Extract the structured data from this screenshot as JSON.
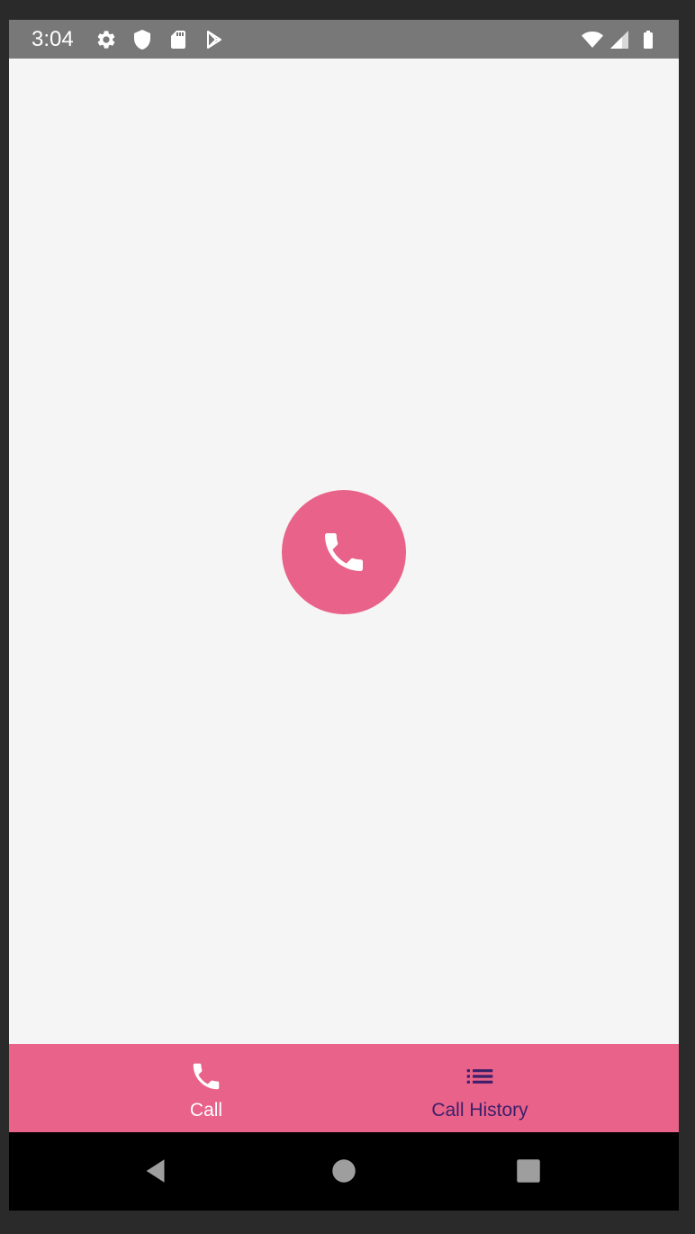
{
  "status_bar": {
    "time": "3:04",
    "left_icons": [
      "settings-icon",
      "shield-icon",
      "sd-card-icon",
      "play-store-icon"
    ],
    "right_icons": [
      "wifi-icon",
      "signal-icon",
      "battery-icon"
    ],
    "background_color": "#787878"
  },
  "main": {
    "call_button": {
      "icon": "phone-icon",
      "color": "#e9628a"
    }
  },
  "bottom_nav": {
    "background_color": "#e9628a",
    "items": [
      {
        "label": "Call",
        "icon": "phone-icon",
        "active": true
      },
      {
        "label": "Call History",
        "icon": "list-icon",
        "active": false
      }
    ]
  },
  "system_nav": {
    "buttons": [
      "back-icon",
      "home-icon",
      "recents-icon"
    ]
  }
}
